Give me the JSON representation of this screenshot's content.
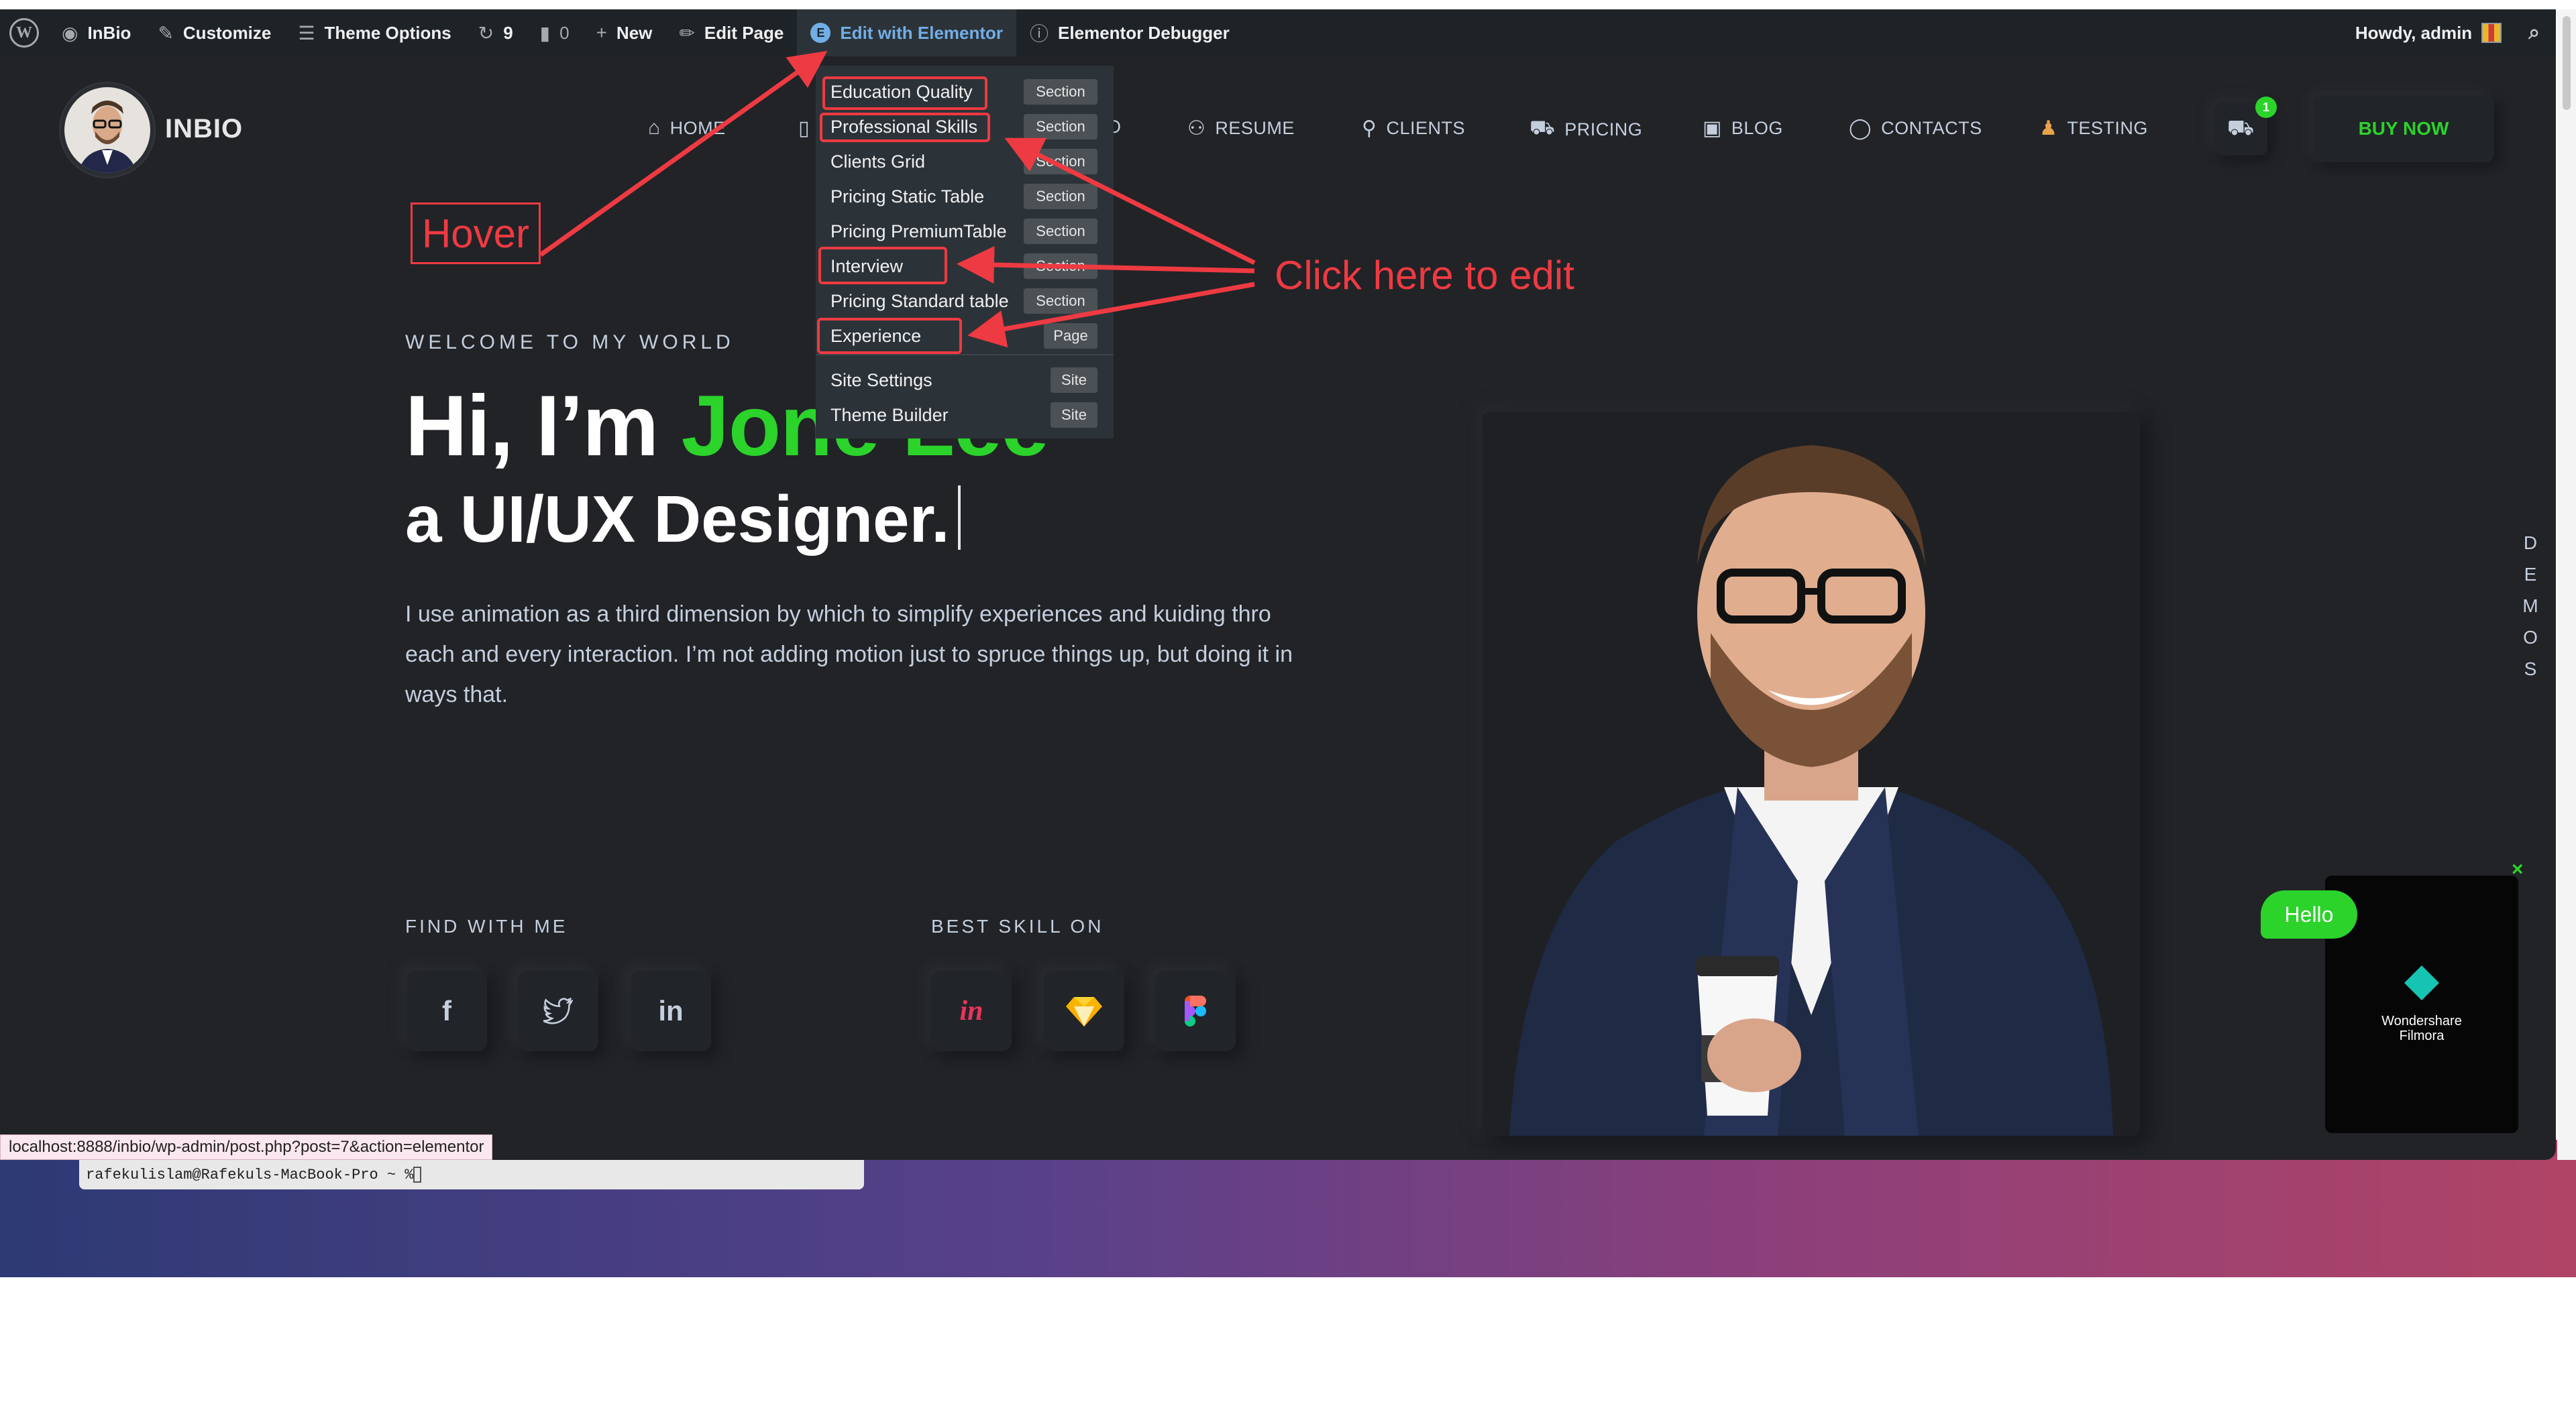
{
  "admin_bar": {
    "site_name": "InBio",
    "customize": "Customize",
    "theme_options": "Theme Options",
    "updates_count": "9",
    "comments_count": "0",
    "new": "New",
    "edit_page": "Edit Page",
    "edit_with_elementor": "Edit with Elementor",
    "elementor_debugger": "Elementor Debugger",
    "howdy": "Howdy, admin"
  },
  "elementor_dropdown": {
    "items": [
      {
        "label": "Education Quality",
        "badge": "Section"
      },
      {
        "label": "Professional Skills",
        "badge": "Section"
      },
      {
        "label": "Clients Grid",
        "badge": "Section"
      },
      {
        "label": "Pricing Static Table",
        "badge": "Section"
      },
      {
        "label": "Pricing PremiumTable",
        "badge": "Section"
      },
      {
        "label": "Interview",
        "badge": "Section"
      },
      {
        "label": "Pricing Standard table",
        "badge": "Section"
      },
      {
        "label": "Experience",
        "badge": "Page"
      },
      {
        "label": "Site Settings",
        "badge": "Site"
      },
      {
        "label": "Theme Builder",
        "badge": "Site"
      }
    ]
  },
  "header": {
    "logo_text": "INBIO",
    "nav": [
      {
        "label": "HOME",
        "icon": "home-icon"
      },
      {
        "label": "O",
        "icon": "portfolio-icon"
      },
      {
        "label": "RESUME",
        "icon": "users-icon"
      },
      {
        "label": "CLIENTS",
        "icon": "user-icon"
      },
      {
        "label": "PRICING",
        "icon": "cart-icon"
      },
      {
        "label": "BLOG",
        "icon": "image-icon"
      },
      {
        "label": "CONTACTS",
        "icon": "chat-icon"
      },
      {
        "label": "TESTING",
        "icon": "person-icon"
      }
    ],
    "cart_count": "1",
    "buy_now": "BUY NOW"
  },
  "hero": {
    "welcome": "WELCOME TO MY WORLD",
    "greeting": "Hi, I’m ",
    "name": "Jone Lee",
    "role": "a UI/UX Designer.",
    "description": "I use animation as a third dimension by which to simplify experiences and kuiding thro each and every interaction. I’m not adding motion just to spruce things up, but doing it in ways that.",
    "find_with_me": "FIND WITH ME",
    "best_skill_on": "BEST SKILL ON",
    "social": [
      "facebook-icon",
      "twitter-icon",
      "linkedin-icon"
    ],
    "skills": [
      "invision-icon",
      "sketch-icon",
      "figma-icon"
    ]
  },
  "demos_tab": [
    "D",
    "E",
    "M",
    "O",
    "S"
  ],
  "chat": {
    "hello": "Hello"
  },
  "filmora": {
    "line1": "Wondershare",
    "line2": "Filmora"
  },
  "annotations": {
    "hover": "Hover",
    "click_here": "Click here to edit"
  },
  "status_url": "localhost:8888/inbio/wp-admin/post.php?post=7&action=elementor",
  "terminal_prompt": "rafekulislam@Rafekuls-MacBook-Pro ~ % ",
  "colors": {
    "accent_green": "#2bd32b",
    "background": "#212327",
    "annotation_red": "#ee3a42",
    "admin_bar": "#1d2327"
  }
}
